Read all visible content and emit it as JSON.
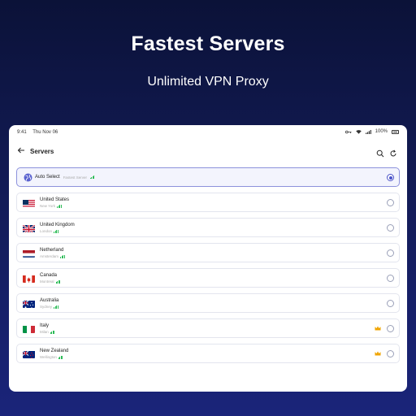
{
  "hero": {
    "title": "Fastest Servers",
    "subtitle": "Unlimited VPN Proxy"
  },
  "statusbar": {
    "time": "9:41",
    "date": "Thu Nov 06",
    "battery": "100%"
  },
  "appbar": {
    "title": "Servers",
    "back_icon": "back-arrow-icon",
    "search_icon": "search-icon",
    "refresh_icon": "refresh-icon"
  },
  "auto_select": {
    "label": "Auto Select",
    "tag": "Fastest Server",
    "icon": "globe-icon",
    "selected": true
  },
  "servers": [
    {
      "name": "United States",
      "city": "New York",
      "flag": "us",
      "premium": false,
      "selected": false
    },
    {
      "name": "United Kingdom",
      "city": "London",
      "flag": "uk",
      "premium": false,
      "selected": false
    },
    {
      "name": "Netherland",
      "city": "Amsterdam",
      "flag": "nl",
      "premium": false,
      "selected": false
    },
    {
      "name": "Canada",
      "city": "Montreal",
      "flag": "ca",
      "premium": false,
      "selected": false
    },
    {
      "name": "Australia",
      "city": "Sydney",
      "flag": "au",
      "premium": false,
      "selected": false
    },
    {
      "name": "Italy",
      "city": "Milan",
      "flag": "it",
      "premium": true,
      "selected": false
    },
    {
      "name": "New Zealand",
      "city": "Wellington",
      "flag": "nz",
      "premium": true,
      "selected": false
    }
  ],
  "colors": {
    "accent": "#4a52c8",
    "signal": "#2ebc58",
    "premium": "#f0a500",
    "background_top": "#0b1238",
    "background_bottom": "#1a247a"
  }
}
